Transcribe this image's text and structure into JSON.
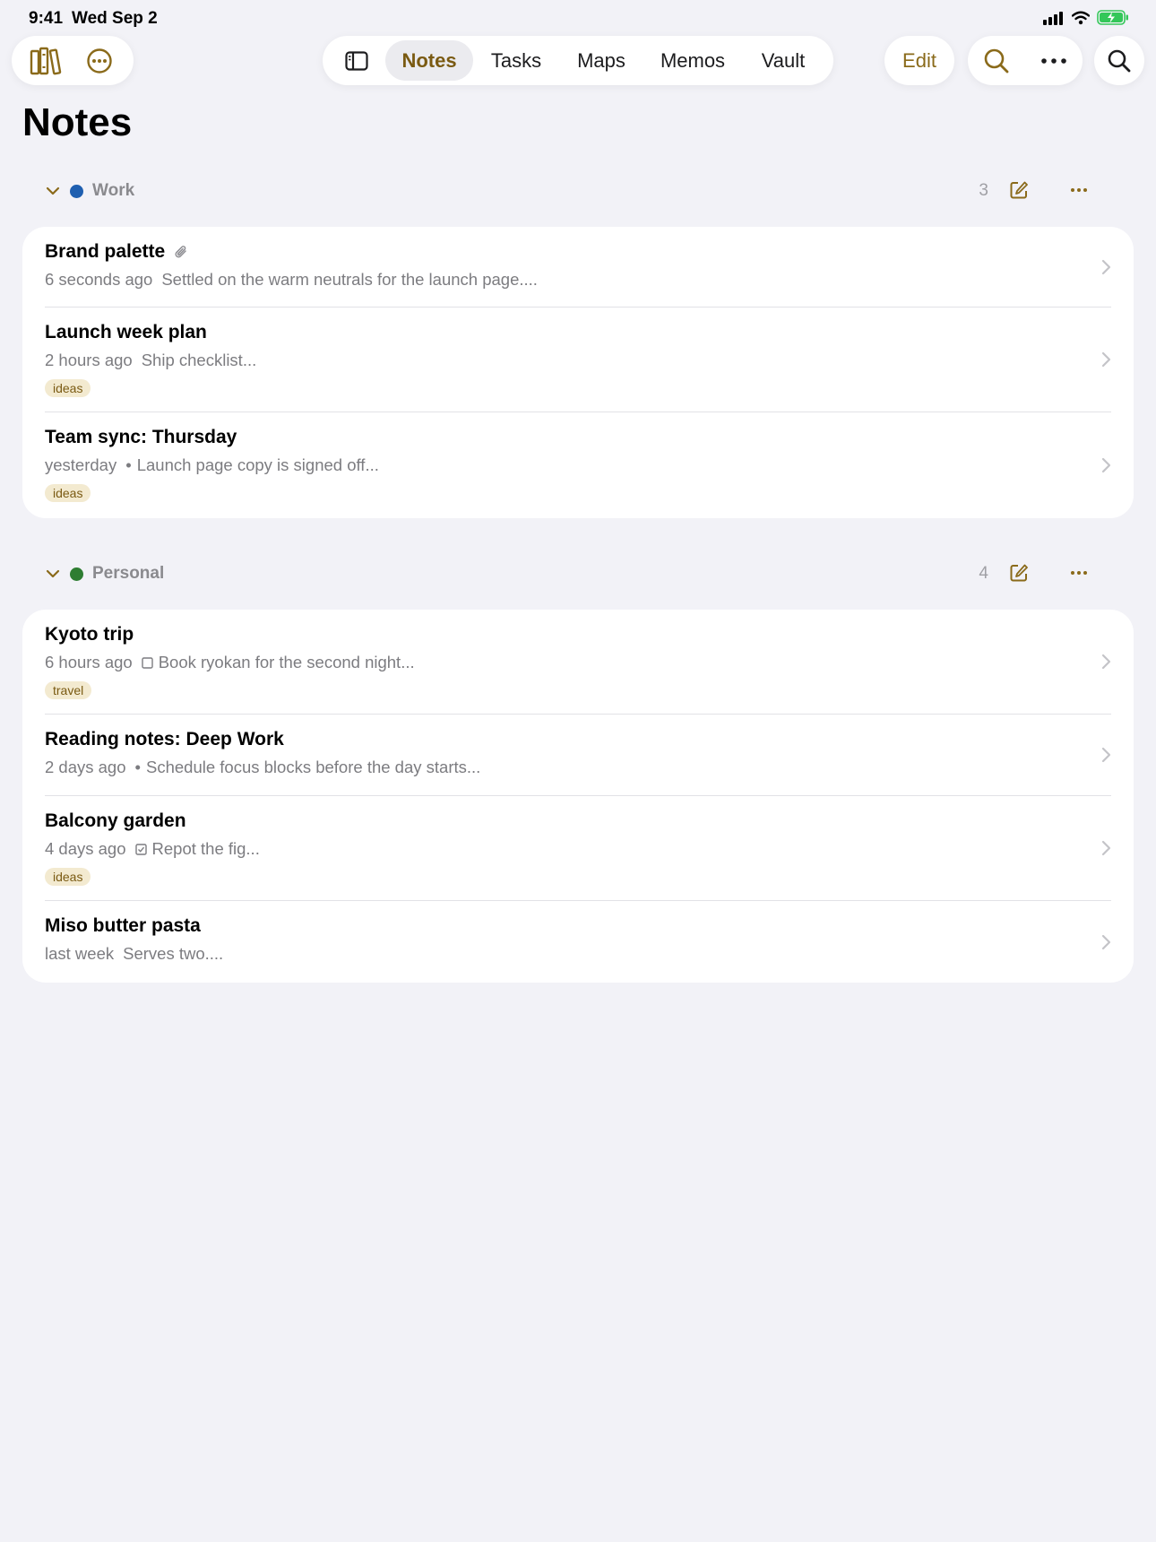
{
  "status": {
    "time": "9:41",
    "date": "Wed Sep 2"
  },
  "tabs": [
    {
      "label": "Notes",
      "active": true
    },
    {
      "label": "Tasks",
      "active": false
    },
    {
      "label": "Maps",
      "active": false
    },
    {
      "label": "Memos",
      "active": false
    },
    {
      "label": "Vault",
      "active": false
    }
  ],
  "toolbar": {
    "edit_label": "Edit"
  },
  "page": {
    "title": "Notes"
  },
  "colors": {
    "accent": "#8a6a1a",
    "work": "#1f5fb0",
    "personal": "#2e7d32"
  },
  "sections": [
    {
      "name": "Work",
      "count": "3",
      "notes": [
        {
          "title": "Brand palette",
          "time": "6 seconds ago",
          "preview": "Settled on the warm neutrals for the launch page....",
          "mark": "none",
          "attachment": true
        },
        {
          "title": "Launch week plan",
          "time": "2 hours ago",
          "preview": "Ship checklist...",
          "mark": "none",
          "tag": "ideas"
        },
        {
          "title": "Team sync: Thursday",
          "time": "yesterday",
          "preview": "Launch page copy is signed off...",
          "mark": "bullet",
          "tag": "ideas"
        }
      ]
    },
    {
      "name": "Personal",
      "count": "4",
      "notes": [
        {
          "title": "Kyoto trip",
          "time": "6 hours ago",
          "preview": "Book ryokan for the second night...",
          "mark": "checkbox-empty",
          "tag": "travel"
        },
        {
          "title": "Reading notes: Deep Work",
          "time": "2 days ago",
          "preview": "Schedule focus blocks before the day starts...",
          "mark": "bullet"
        },
        {
          "title": "Balcony garden",
          "time": "4 days ago",
          "preview": "Repot the fig...",
          "mark": "checkbox-checked",
          "tag": "ideas"
        },
        {
          "title": "Miso butter pasta",
          "time": "last week",
          "preview": "Serves two....",
          "mark": "none"
        }
      ]
    }
  ]
}
